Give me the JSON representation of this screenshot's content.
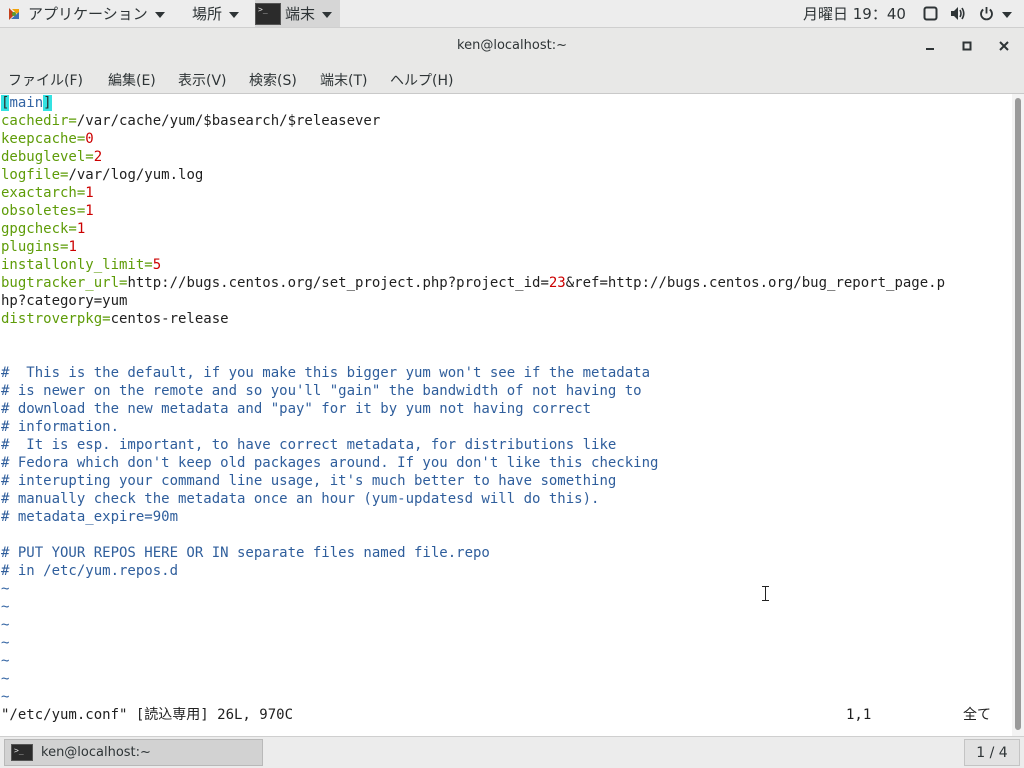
{
  "topbar": {
    "apps_label": "アプリケーション",
    "places_label": "場所",
    "terminal_label": "端末",
    "clock": "月曜日 19：40"
  },
  "window": {
    "title": "ken@localhost:~",
    "minimize": "‒",
    "maximize": "▫",
    "close": "✕"
  },
  "menu": {
    "file": "ファイル(F)",
    "edit": "編集(E)",
    "view": "表示(V)",
    "search": "検索(S)",
    "terminal": "端末(T)",
    "help": "ヘルプ(H)"
  },
  "editor": {
    "lines": [
      {
        "segs": [
          {
            "t": "[",
            "c": "hl"
          },
          {
            "t": "main",
            "c": "t"
          },
          {
            "t": "]",
            "c": "hl"
          }
        ]
      },
      {
        "segs": [
          {
            "t": "cachedir=",
            "c": "k"
          },
          {
            "t": "/var/cache/yum/$basearch/$releasever",
            "c": ""
          }
        ]
      },
      {
        "segs": [
          {
            "t": "keepcache=",
            "c": "k"
          },
          {
            "t": "0",
            "c": "n"
          }
        ]
      },
      {
        "segs": [
          {
            "t": "debuglevel=",
            "c": "k"
          },
          {
            "t": "2",
            "c": "n"
          }
        ]
      },
      {
        "segs": [
          {
            "t": "logfile=",
            "c": "k"
          },
          {
            "t": "/var/log/yum.log",
            "c": ""
          }
        ]
      },
      {
        "segs": [
          {
            "t": "exactarch=",
            "c": "k"
          },
          {
            "t": "1",
            "c": "n"
          }
        ]
      },
      {
        "segs": [
          {
            "t": "obsoletes=",
            "c": "k"
          },
          {
            "t": "1",
            "c": "n"
          }
        ]
      },
      {
        "segs": [
          {
            "t": "gpgcheck=",
            "c": "k"
          },
          {
            "t": "1",
            "c": "n"
          }
        ]
      },
      {
        "segs": [
          {
            "t": "plugins=",
            "c": "k"
          },
          {
            "t": "1",
            "c": "n"
          }
        ]
      },
      {
        "segs": [
          {
            "t": "installonly_limit=",
            "c": "k"
          },
          {
            "t": "5",
            "c": "n"
          }
        ]
      },
      {
        "segs": [
          {
            "t": "bugtracker_url=",
            "c": "k"
          },
          {
            "t": "http://bugs.centos.org/set_project.php?project_id=",
            "c": ""
          },
          {
            "t": "23",
            "c": "n"
          },
          {
            "t": "&ref=http://bugs.centos.org/bug_report_page.p",
            "c": ""
          }
        ]
      },
      {
        "segs": [
          {
            "t": "hp?category=yum",
            "c": ""
          }
        ]
      },
      {
        "segs": [
          {
            "t": "distroverpkg=",
            "c": "k"
          },
          {
            "t": "centos-release",
            "c": ""
          }
        ]
      },
      {
        "segs": []
      },
      {
        "segs": []
      },
      {
        "segs": [
          {
            "t": "#  This is the default, if you make this bigger yum won't see if the metadata",
            "c": "c"
          }
        ]
      },
      {
        "segs": [
          {
            "t": "# is newer on the remote and so you'll \"gain\" the bandwidth of not having to",
            "c": "c"
          }
        ]
      },
      {
        "segs": [
          {
            "t": "# download the new metadata and \"pay\" for it by yum not having correct",
            "c": "c"
          }
        ]
      },
      {
        "segs": [
          {
            "t": "# information.",
            "c": "c"
          }
        ]
      },
      {
        "segs": [
          {
            "t": "#  It is esp. important, to have correct metadata, for distributions like",
            "c": "c"
          }
        ]
      },
      {
        "segs": [
          {
            "t": "# Fedora which don't keep old packages around. If you don't like this checking",
            "c": "c"
          }
        ]
      },
      {
        "segs": [
          {
            "t": "# interupting your command line usage, it's much better to have something",
            "c": "c"
          }
        ]
      },
      {
        "segs": [
          {
            "t": "# manually check the metadata once an hour (yum-updatesd will do this).",
            "c": "c"
          }
        ]
      },
      {
        "segs": [
          {
            "t": "# metadata_expire=90m",
            "c": "c"
          }
        ]
      },
      {
        "segs": []
      },
      {
        "segs": [
          {
            "t": "# PUT YOUR REPOS HERE OR IN separate files named file.repo",
            "c": "c"
          }
        ]
      },
      {
        "segs": [
          {
            "t": "# in /etc/yum.repos.d",
            "c": "c"
          }
        ]
      },
      {
        "segs": [
          {
            "t": "~",
            "c": "t"
          }
        ]
      },
      {
        "segs": [
          {
            "t": "~",
            "c": "t"
          }
        ]
      },
      {
        "segs": [
          {
            "t": "~",
            "c": "t"
          }
        ]
      },
      {
        "segs": [
          {
            "t": "~",
            "c": "t"
          }
        ]
      },
      {
        "segs": [
          {
            "t": "~",
            "c": "t"
          }
        ]
      },
      {
        "segs": [
          {
            "t": "~",
            "c": "t"
          }
        ]
      },
      {
        "segs": [
          {
            "t": "~",
            "c": "t"
          }
        ]
      }
    ],
    "status_left": "\"/etc/yum.conf\" [読込専用] 26L, 970C",
    "status_pos": "1,1",
    "status_right": "全て"
  },
  "taskbar": {
    "window_label": "ken@localhost:~",
    "workspace": "1 / 4"
  },
  "colors": {
    "keyword": "#5e9c08",
    "number": "#cc0000",
    "comment": "#2f5e9c",
    "tilde": "#3465a4",
    "highlight": "#34e2e2"
  },
  "icons": [
    "apps-icon",
    "terminal-icon",
    "window-switch-icon",
    "volume-icon",
    "power-icon"
  ]
}
